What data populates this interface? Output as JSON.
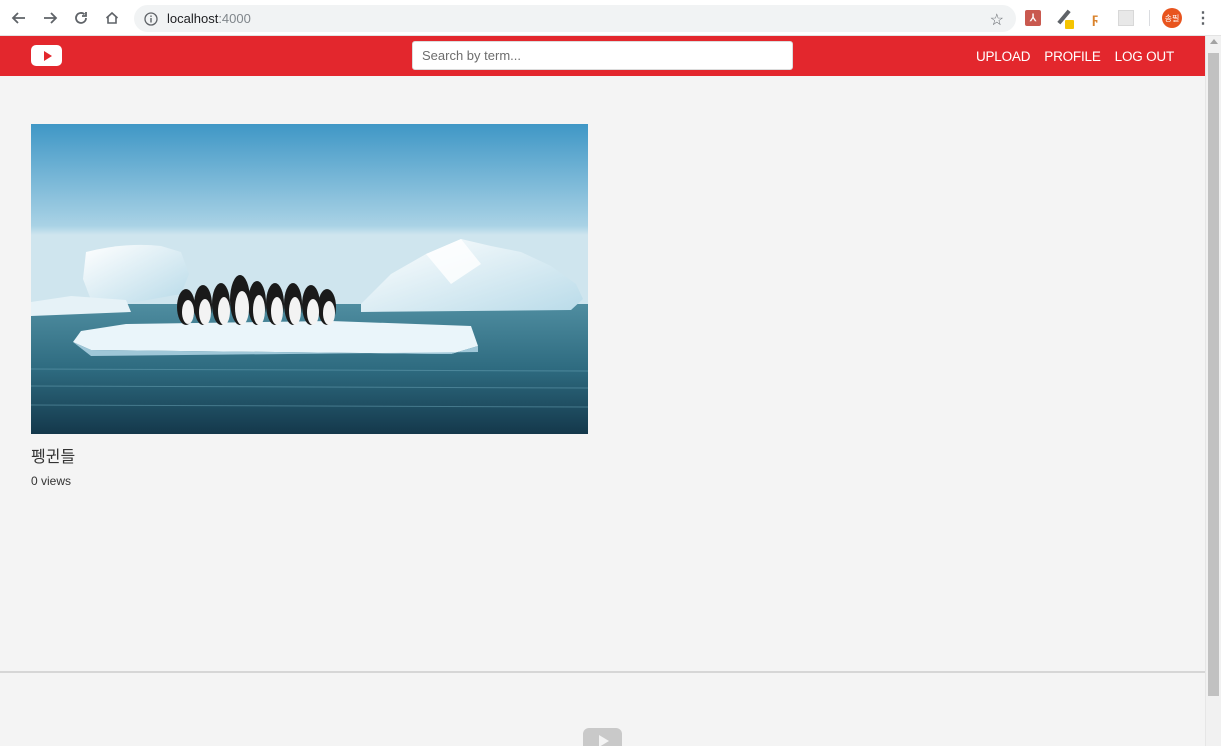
{
  "browser": {
    "url_host": "localhost",
    "url_port": ":4000",
    "profile_initials": "송필"
  },
  "header": {
    "search_placeholder": "Search by term...",
    "links": [
      {
        "label": "UPLOAD"
      },
      {
        "label": "PROFILE"
      },
      {
        "label": "LOG OUT"
      }
    ]
  },
  "videos": [
    {
      "title": "펭귄들",
      "views": "0 views"
    }
  ],
  "colors": {
    "brand": "#e3272d",
    "background": "#f4f4f4"
  }
}
